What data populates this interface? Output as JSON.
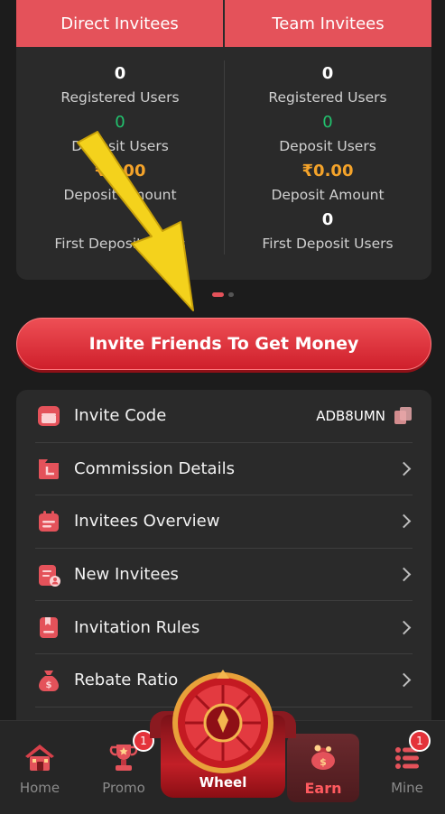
{
  "stats": {
    "tabs": [
      "Direct Invitees",
      "Team Invitees"
    ],
    "direct": {
      "registered_users": "0",
      "registered_users_label": "Registered Users",
      "deposit_users": "0",
      "deposit_users_label": "Deposit Users",
      "deposit_amount": "₹0.00",
      "deposit_amount_label": "Deposit Amount",
      "first_deposit_label": "First Deposit Users"
    },
    "team": {
      "registered_users": "0",
      "registered_users_label": "Registered Users",
      "deposit_users": "0",
      "deposit_users_label": "Deposit Users",
      "deposit_amount": "₹0.00",
      "deposit_amount_label": "Deposit Amount",
      "first_deposit_users": "0",
      "first_deposit_label": "First Deposit Users"
    }
  },
  "invite_button": "Invite Friends To Get Money",
  "menu": {
    "invite_code_label": "Invite Code",
    "invite_code_value": "ADB8UMN",
    "items": [
      "Commission Details",
      "Invitees Overview",
      "New Invitees",
      "Invitation Rules",
      "Rebate Ratio"
    ]
  },
  "nav": {
    "home": "Home",
    "promo": "Promo",
    "promo_badge": "1",
    "wheel": "Wheel",
    "earn": "Earn",
    "mine": "Mine",
    "mine_badge": "1"
  },
  "colors": {
    "accent": "#e4525a",
    "green": "#22c26e",
    "orange": "#f4a32a",
    "arrow": "#f4d21c"
  }
}
